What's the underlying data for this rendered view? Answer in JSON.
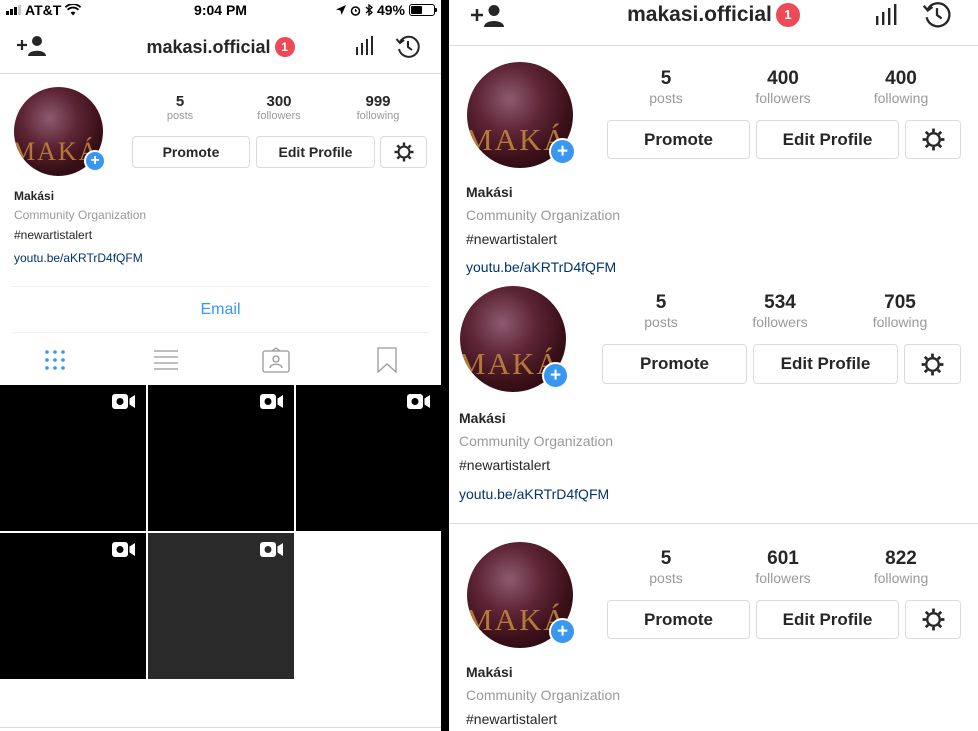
{
  "left": {
    "status_bar": {
      "carrier": "AT&T",
      "time": "9:04 PM",
      "battery": "49%",
      "battery_level": 0.49
    },
    "header": {
      "username": "makasi.official",
      "notification_count": "1"
    },
    "profile": {
      "posts": "5",
      "posts_label": "posts",
      "followers": "300",
      "followers_label": "followers",
      "following": "999",
      "following_label": "following",
      "promote_label": "Promote",
      "edit_label": "Edit Profile",
      "name": "Makási",
      "category": "Community Organization",
      "bio": "#newartistalert",
      "link": "youtu.be/aKRTrD4fQFM",
      "avatar_text": "MAKÁS"
    },
    "email_label": "Email",
    "view_tabs": [
      "grid-icon",
      "list-icon",
      "tagged-icon",
      "saved-icon"
    ],
    "posts_grid": [
      {
        "type": "video",
        "shade": "black"
      },
      {
        "type": "video",
        "shade": "black"
      },
      {
        "type": "video",
        "shade": "black"
      },
      {
        "type": "video",
        "shade": "black"
      },
      {
        "type": "video",
        "shade": "gray"
      }
    ]
  },
  "right": {
    "header": {
      "username": "makasi.official",
      "notification_count": "1"
    },
    "profiles": [
      {
        "posts": "5",
        "posts_label": "posts",
        "followers": "400",
        "followers_label": "followers",
        "following": "400",
        "following_label": "following",
        "promote_label": "Promote",
        "edit_label": "Edit Profile",
        "name": "Makási",
        "category": "Community Organization",
        "bio": "#newartistalert",
        "link": "youtu.be/aKRTrD4fQFM",
        "avatar_text": "MAKÁS"
      },
      {
        "posts": "5",
        "posts_label": "posts",
        "followers": "534",
        "followers_label": "followers",
        "following": "705",
        "following_label": "following",
        "promote_label": "Promote",
        "edit_label": "Edit Profile",
        "name": "Makási",
        "category": "Community Organization",
        "bio": "#newartistalert",
        "link": "youtu.be/aKRTrD4fQFM",
        "avatar_text": "MAKÁS"
      },
      {
        "posts": "5",
        "posts_label": "posts",
        "followers": "601",
        "followers_label": "followers",
        "following": "822",
        "following_label": "following",
        "promote_label": "Promote",
        "edit_label": "Edit Profile",
        "name": "Makási",
        "category": "Community Organization",
        "bio": "#newartistalert",
        "avatar_text": "MAKÁS"
      }
    ]
  },
  "colors": {
    "accent_blue": "#3897f0",
    "badge_red": "#ed4956",
    "link": "#003569",
    "muted": "#999999",
    "border": "#dbdbdb"
  }
}
